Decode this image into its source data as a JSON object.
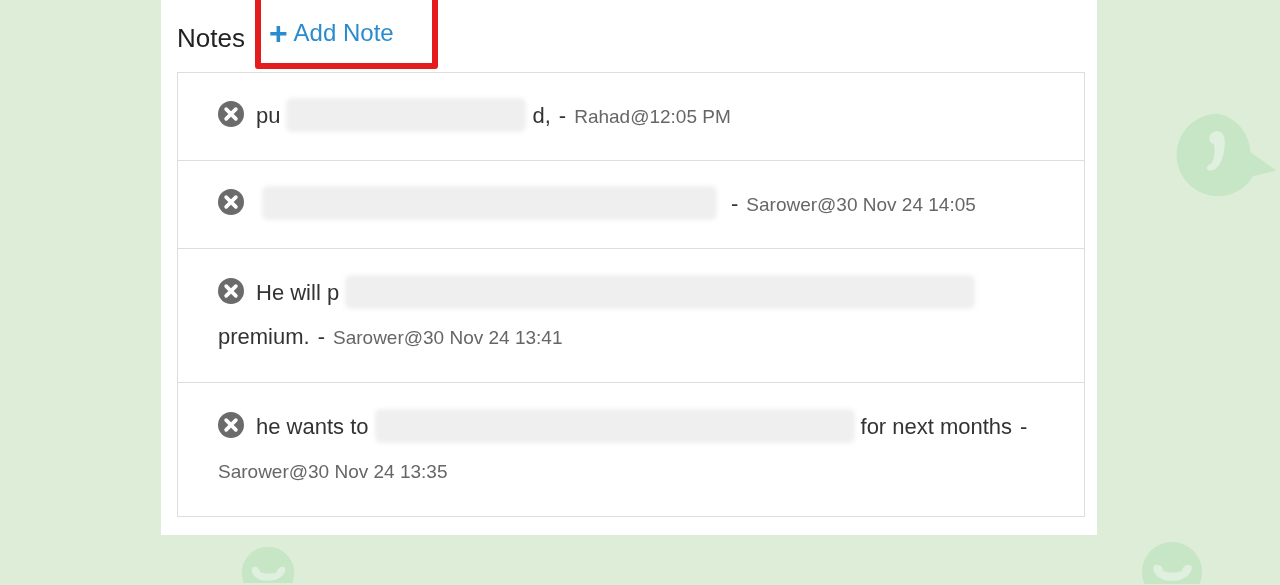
{
  "notes_panel": {
    "title": "Notes",
    "add_note": {
      "icon": "+",
      "label": "Add Note",
      "highlighted": true
    },
    "notes": [
      {
        "parts": [
          {
            "kind": "text",
            "text": "pu"
          },
          {
            "kind": "redacted"
          },
          {
            "kind": "text",
            "text": "d,"
          }
        ],
        "separator": "-",
        "author_time": "Rahad@12:05 PM"
      },
      {
        "parts": [
          {
            "kind": "redacted"
          }
        ],
        "separator": "-",
        "author_time": "Sarower@30 Nov 24 14:05"
      },
      {
        "parts": [
          {
            "kind": "text",
            "text": "He will p"
          },
          {
            "kind": "redacted"
          },
          {
            "kind": "text",
            "text": "premium."
          }
        ],
        "separator": "-",
        "author_time": "Sarower@30 Nov 24 13:41"
      },
      {
        "parts": [
          {
            "kind": "text",
            "text": "he wants to"
          },
          {
            "kind": "redacted"
          },
          {
            "kind": "text",
            "text": "for"
          },
          {
            "kind": "text",
            "text": "next months"
          }
        ],
        "separator": "-",
        "author_time": "Sarower@30 Nov 24 13:35"
      }
    ]
  }
}
